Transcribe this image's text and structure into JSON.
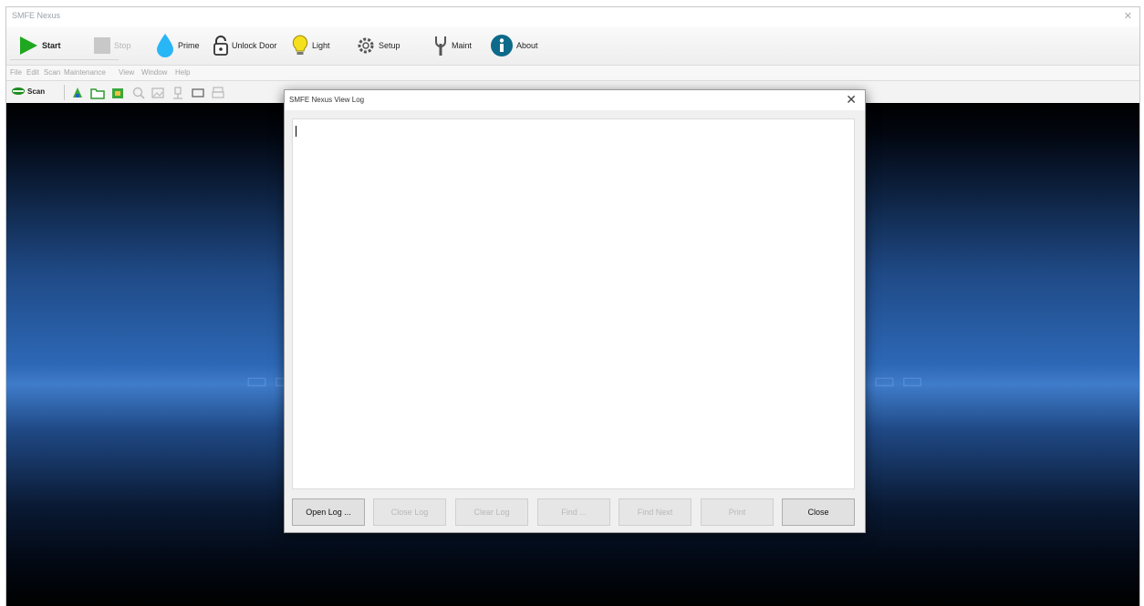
{
  "app": {
    "title": "SMFE Nexus"
  },
  "toolbar": {
    "buttons": [
      {
        "label": "Start",
        "icon": "play-icon",
        "enabled": true
      },
      {
        "label": "Stop",
        "icon": "stop-icon",
        "enabled": false
      },
      {
        "label": "Prime",
        "icon": "droplet-icon",
        "enabled": true
      },
      {
        "label": "Unlock Door",
        "icon": "padlock-icon",
        "enabled": true
      },
      {
        "label": "Light",
        "icon": "lightbulb-icon",
        "enabled": true
      },
      {
        "label": "Setup",
        "icon": "gear-icon",
        "enabled": true
      },
      {
        "label": "Maint",
        "icon": "wrench-icon",
        "enabled": true
      },
      {
        "label": "About",
        "icon": "info-icon",
        "enabled": true
      }
    ]
  },
  "menu": {
    "items": [
      "File",
      "Edit",
      "Scan",
      "Maintenance",
      "View",
      "Window",
      "Help"
    ]
  },
  "secondary_toolbar": {
    "scan_label": "Scan",
    "icons": [
      "scan-icon",
      "sample-icon",
      "folder-icon",
      "export-icon",
      "zoom-icon",
      "image-icon",
      "pin-icon",
      "rectangle-icon",
      "print-icon"
    ]
  },
  "dialog": {
    "title": "SMFE Nexus View Log",
    "buttons": [
      {
        "label": "Open Log ...",
        "enabled": true
      },
      {
        "label": "Close Log",
        "enabled": false
      },
      {
        "label": "Clear Log",
        "enabled": false
      },
      {
        "label": "Find ...",
        "enabled": false
      },
      {
        "label": "Find Next",
        "enabled": false
      },
      {
        "label": "Print",
        "enabled": false
      },
      {
        "label": "Close",
        "enabled": true
      }
    ]
  },
  "colors": {
    "accent_green": "#1fa81f",
    "droplet": "#29b6f6",
    "bulb": "#f5e01e",
    "info": "#0d6a8a"
  }
}
